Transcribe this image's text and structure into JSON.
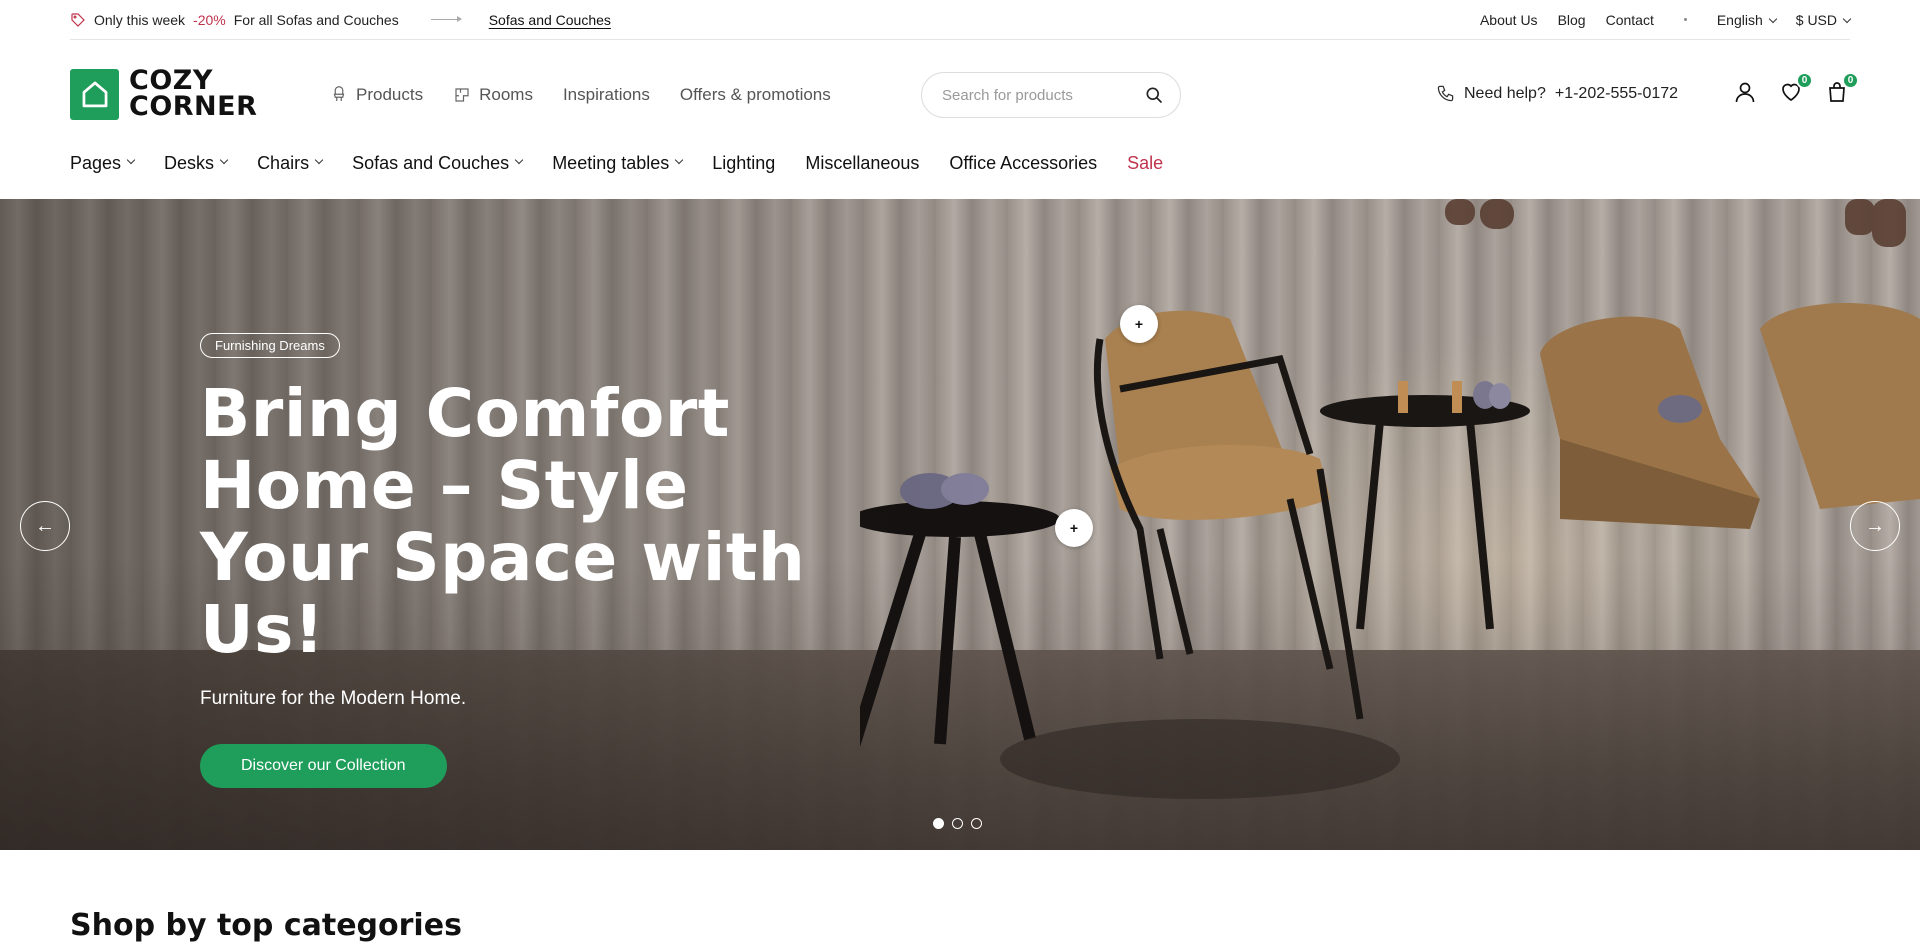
{
  "topbar": {
    "promo_prefix": "Only this week",
    "promo_percent": "-20%",
    "promo_suffix": "For all Sofas and Couches",
    "promo_link": "Sofas and Couches",
    "links": [
      "About Us",
      "Blog",
      "Contact"
    ],
    "language": "English",
    "currency": "$ USD"
  },
  "header": {
    "logo_line1": "COZY",
    "logo_line2": "CORNER",
    "nav": [
      "Products",
      "Rooms",
      "Inspirations",
      "Offers & promotions"
    ],
    "search_placeholder": "Search for products",
    "help_label": "Need help?",
    "help_phone": "+1-202-555-0172",
    "wishlist_count": "0",
    "cart_count": "0"
  },
  "categories": [
    "Pages",
    "Desks",
    "Chairs",
    "Sofas and Couches",
    "Meeting tables",
    "Lighting",
    "Miscellaneous",
    "Office Accessories",
    "Sale"
  ],
  "hero": {
    "badge": "Furnishing Dreams",
    "title_line1": "Bring Comfort",
    "title_line2": "Home – Style",
    "title_line3": "Your Space with Us!",
    "subtitle": "Furniture for the Modern Home.",
    "cta": "Discover our Collection",
    "prev_arrow": "←",
    "next_arrow": "→",
    "hotspot_symbol": "+",
    "active_slide": 1,
    "slide_count": 3
  },
  "section": {
    "title": "Shop by top categories"
  },
  "colors": {
    "brand_green": "#1f9d5a",
    "sale_red": "#c0334d"
  }
}
